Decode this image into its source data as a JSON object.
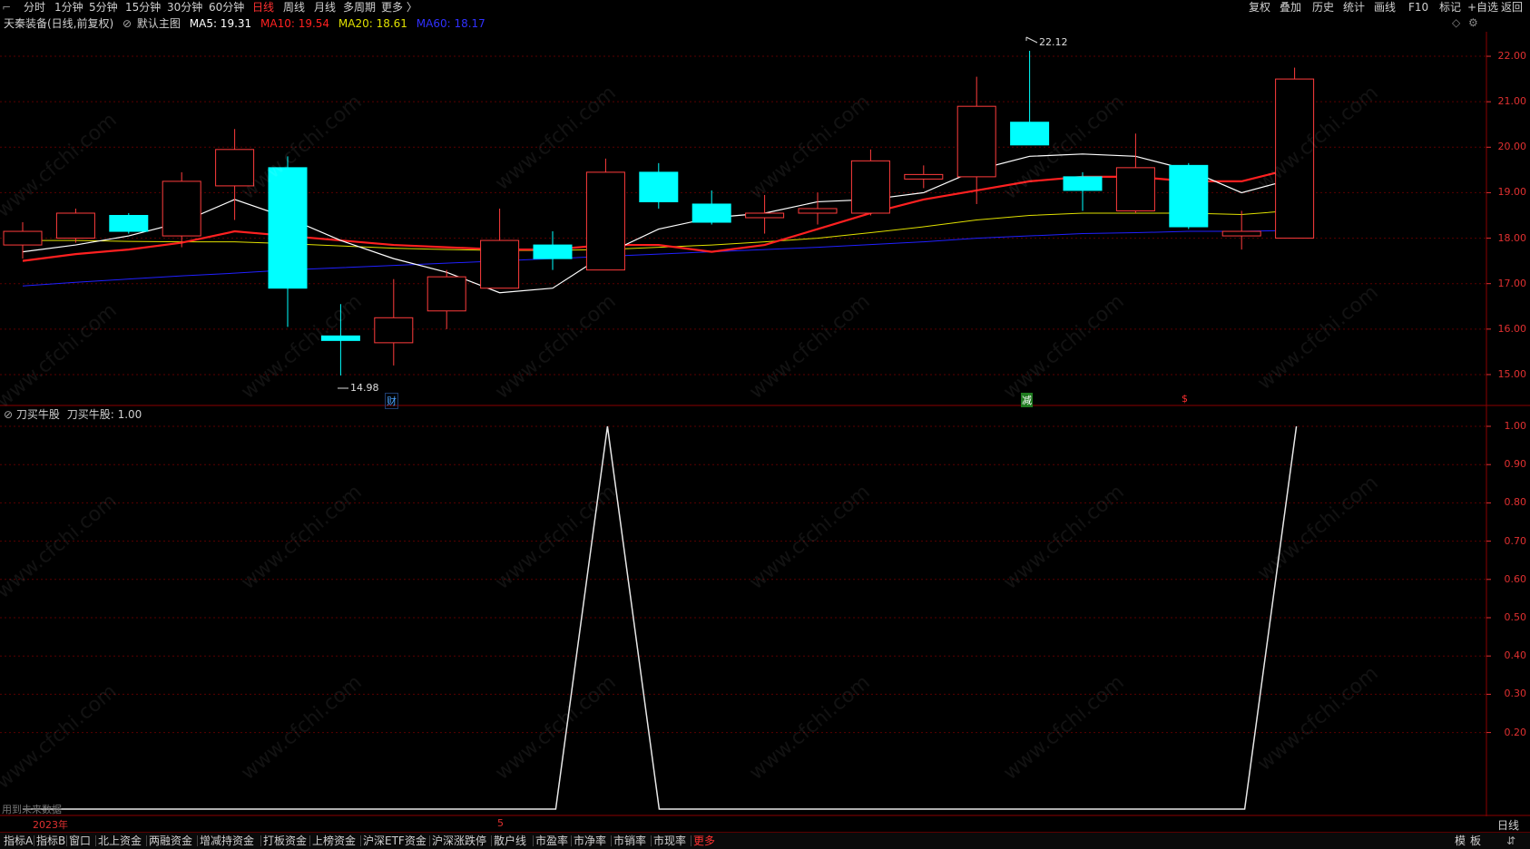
{
  "top_tabs": [
    "分时",
    "1分钟",
    "5分钟",
    "15分钟",
    "30分钟",
    "60分钟",
    "日线",
    "周线",
    "月线",
    "多周期",
    "更多 〉"
  ],
  "top_tab_active": "日线",
  "right_tools": [
    "复权",
    "叠加",
    "历史",
    "统计",
    "画线",
    "F10",
    "标记",
    "+自选",
    "返回"
  ],
  "info": {
    "stock": "天秦装备(日线,前复权)",
    "main_label": "默认主图",
    "ma5": "MA5: 19.31",
    "ma10": "MA10: 19.54",
    "ma20": "MA20: 18.61",
    "ma60": "MA60: 18.17"
  },
  "indicator": {
    "name": "刀买牛股",
    "value_label": "刀买牛股: 1.00"
  },
  "price_axis": [
    "22.00",
    "21.00",
    "20.00",
    "19.00",
    "18.00",
    "17.00",
    "16.00",
    "15.00"
  ],
  "ind_axis": [
    "1.00",
    "0.90",
    "0.80",
    "0.70",
    "0.60",
    "0.50",
    "0.40",
    "0.30",
    "0.20"
  ],
  "annotations": {
    "high": "22.12",
    "low": "14.98",
    "mark_cai": "财",
    "mark_jian": "减",
    "mark_dollar": "$",
    "future_note": "用到未来数据",
    "year_label": "2023年",
    "month_label": "5",
    "period_label": "日线"
  },
  "bottom_tabs": [
    "指标A",
    "指标B",
    "窗口",
    "北上资金",
    "两融资金",
    "增减持资金",
    "打板资金",
    "上榜资金",
    "沪深ETF资金",
    "沪深涨跌停",
    "散户线",
    "市盈率",
    "市净率",
    "市销率",
    "市现率",
    "更多"
  ],
  "bottom_tab_active": "更多",
  "bottom_right": [
    "模",
    "板"
  ],
  "watermark": "www.cfchi.com",
  "colors": {
    "up": "#ff3c3c",
    "down": "#00ffff",
    "ma5": "#ffffff",
    "ma10": "#ff2020",
    "ma20": "#e0e000",
    "ma60": "#2020ff",
    "axis": "#e03030"
  },
  "chart_data": {
    "type": "candlestick",
    "price_range": [
      14.7,
      22.3
    ],
    "candles": [
      {
        "o": 17.85,
        "c": 18.15,
        "h": 18.35,
        "l": 17.55
      },
      {
        "o": 18.0,
        "c": 18.55,
        "h": 18.65,
        "l": 17.9
      },
      {
        "o": 18.5,
        "c": 18.15,
        "h": 18.55,
        "l": 18.1
      },
      {
        "o": 18.05,
        "c": 19.25,
        "h": 19.45,
        "l": 17.8
      },
      {
        "o": 19.15,
        "c": 19.95,
        "h": 20.4,
        "l": 18.4
      },
      {
        "o": 19.55,
        "c": 16.9,
        "h": 19.8,
        "l": 16.05
      },
      {
        "o": 15.85,
        "c": 15.75,
        "h": 16.55,
        "l": 14.98
      },
      {
        "o": 15.7,
        "c": 16.25,
        "h": 17.1,
        "l": 15.2
      },
      {
        "o": 16.4,
        "c": 17.15,
        "h": 17.3,
        "l": 16.0
      },
      {
        "o": 16.9,
        "c": 17.95,
        "h": 18.65,
        "l": 16.9
      },
      {
        "o": 17.85,
        "c": 17.55,
        "h": 18.15,
        "l": 17.3
      },
      {
        "o": 17.3,
        "c": 19.45,
        "h": 19.75,
        "l": 17.3
      },
      {
        "o": 19.45,
        "c": 18.8,
        "h": 19.65,
        "l": 18.65
      },
      {
        "o": 18.75,
        "c": 18.35,
        "h": 19.05,
        "l": 18.3
      },
      {
        "o": 18.45,
        "c": 18.55,
        "h": 18.95,
        "l": 18.1
      },
      {
        "o": 18.55,
        "c": 18.65,
        "h": 19.0,
        "l": 18.3
      },
      {
        "o": 18.55,
        "c": 19.7,
        "h": 19.95,
        "l": 18.5
      },
      {
        "o": 19.3,
        "c": 19.4,
        "h": 19.6,
        "l": 19.1
      },
      {
        "o": 19.35,
        "c": 20.9,
        "h": 21.55,
        "l": 18.75
      },
      {
        "o": 20.55,
        "c": 20.05,
        "h": 22.12,
        "l": 20.05
      },
      {
        "o": 19.35,
        "c": 19.05,
        "h": 19.45,
        "l": 18.6
      },
      {
        "o": 18.6,
        "c": 19.55,
        "h": 20.3,
        "l": 18.55
      },
      {
        "o": 19.6,
        "c": 18.25,
        "h": 19.65,
        "l": 18.2
      },
      {
        "o": 18.05,
        "c": 18.15,
        "h": 18.6,
        "l": 17.75
      },
      {
        "o": 18.0,
        "c": 21.5,
        "h": 21.75,
        "l": 18.0
      }
    ],
    "ma5": [
      17.7,
      17.85,
      18.05,
      18.35,
      18.85,
      18.45,
      17.95,
      17.55,
      17.25,
      16.8,
      16.9,
      17.65,
      18.2,
      18.45,
      18.55,
      18.8,
      18.85,
      19.0,
      19.5,
      19.8,
      19.85,
      19.8,
      19.5,
      19.0,
      19.31
    ],
    "ma10": [
      17.5,
      17.65,
      17.75,
      17.9,
      18.15,
      18.05,
      17.95,
      17.85,
      17.8,
      17.75,
      17.75,
      17.85,
      17.85,
      17.7,
      17.85,
      18.2,
      18.55,
      18.85,
      19.05,
      19.25,
      19.35,
      19.35,
      19.25,
      19.25,
      19.54
    ],
    "ma20": [
      17.95,
      17.95,
      17.93,
      17.92,
      17.92,
      17.88,
      17.83,
      17.78,
      17.75,
      17.73,
      17.73,
      17.75,
      17.8,
      17.85,
      17.92,
      18.0,
      18.12,
      18.25,
      18.4,
      18.5,
      18.55,
      18.55,
      18.55,
      18.52,
      18.61
    ],
    "ma60": [
      16.95,
      17.03,
      17.1,
      17.17,
      17.23,
      17.3,
      17.35,
      17.4,
      17.45,
      17.5,
      17.55,
      17.6,
      17.65,
      17.7,
      17.75,
      17.8,
      17.86,
      17.92,
      18.0,
      18.05,
      18.1,
      18.12,
      18.15,
      18.15,
      18.17
    ],
    "indicator": [
      0,
      0,
      0,
      0,
      0,
      0,
      0,
      0,
      0,
      0,
      0,
      1,
      0,
      0,
      0,
      0,
      0,
      0,
      0,
      0,
      0,
      0,
      0,
      0,
      1
    ],
    "indicator_range": [
      0,
      1.0
    ]
  }
}
